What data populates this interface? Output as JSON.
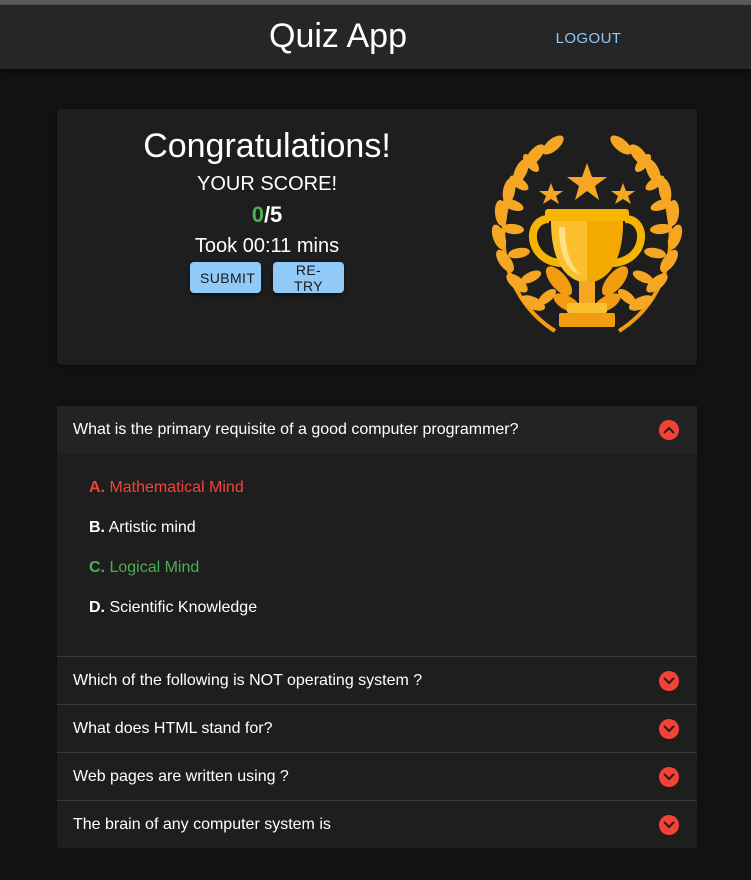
{
  "appbar": {
    "title": "Quiz App",
    "logout_label": "LOGOUT"
  },
  "result": {
    "heading": "Congratulations!",
    "score_label": "YOUR SCORE!",
    "score_got": "0",
    "score_total": "/5",
    "time_text": "Took 00:11 mins",
    "submit_label": "SUBMIT",
    "retry_label": "RE-TRY",
    "trophy_icon": "trophy-icon"
  },
  "colors": {
    "background": "#121212",
    "card": "#1e1e1e",
    "accent_button": "#90caf9",
    "correct": "#4caf50",
    "wrong": "#f44336",
    "trophy_gold": "#f5a623"
  },
  "questions": [
    {
      "text": "What is the primary requisite of a good computer programmer?",
      "expanded": true,
      "options": [
        {
          "letter": "A.",
          "text": "Mathematical Mind",
          "state": "wrong"
        },
        {
          "letter": "B.",
          "text": "Artistic mind",
          "state": "neutral"
        },
        {
          "letter": "C.",
          "text": "Logical Mind",
          "state": "correct"
        },
        {
          "letter": "D.",
          "text": "Scientific Knowledge",
          "state": "neutral"
        }
      ]
    },
    {
      "text": "Which of the following is NOT operating system ?",
      "expanded": false
    },
    {
      "text": "What does HTML stand for?",
      "expanded": false
    },
    {
      "text": "Web pages are written using ?",
      "expanded": false
    },
    {
      "text": "The brain of any computer system is",
      "expanded": false
    }
  ]
}
